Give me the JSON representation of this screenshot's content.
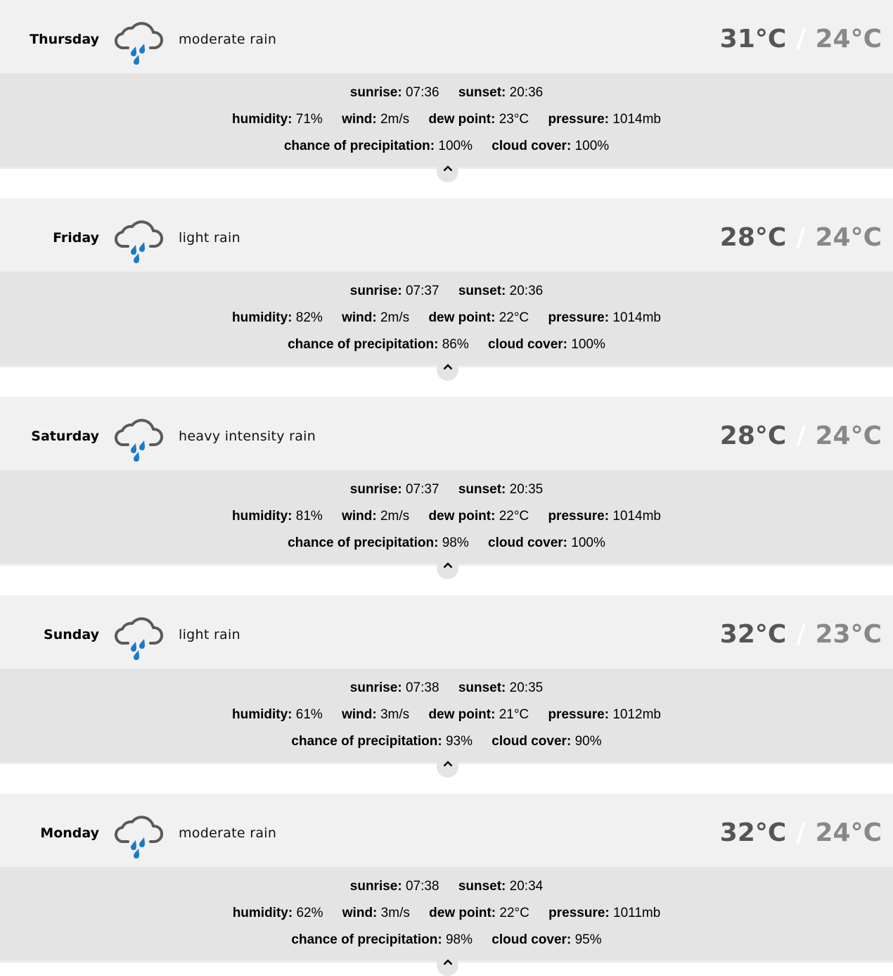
{
  "labels": {
    "sunrise": "sunrise:",
    "sunset": "sunset:",
    "humidity": "humidity:",
    "wind": "wind:",
    "dew_point": "dew point:",
    "pressure": "pressure:",
    "precipitation": "chance of precipitation:",
    "cloud_cover": "cloud cover:",
    "temp_separator": "/"
  },
  "icon": "rain-cloud-icon",
  "colors": {
    "rain_drop": "#1a7ac8",
    "cloud": "#5a5a5a",
    "temp_high": "#555555",
    "temp_low": "#888888"
  },
  "days": [
    {
      "name": "Thursday",
      "description": "moderate rain",
      "high": "31°C",
      "low": "24°C",
      "sunrise": "07:36",
      "sunset": "20:36",
      "humidity": "71%",
      "wind": "2m/s",
      "dew_point": "23°C",
      "pressure": "1014mb",
      "precipitation": "100%",
      "cloud_cover": "100%"
    },
    {
      "name": "Friday",
      "description": "light rain",
      "high": "28°C",
      "low": "24°C",
      "sunrise": "07:37",
      "sunset": "20:36",
      "humidity": "82%",
      "wind": "2m/s",
      "dew_point": "22°C",
      "pressure": "1014mb",
      "precipitation": "86%",
      "cloud_cover": "100%"
    },
    {
      "name": "Saturday",
      "description": "heavy intensity rain",
      "high": "28°C",
      "low": "24°C",
      "sunrise": "07:37",
      "sunset": "20:35",
      "humidity": "81%",
      "wind": "2m/s",
      "dew_point": "22°C",
      "pressure": "1014mb",
      "precipitation": "98%",
      "cloud_cover": "100%"
    },
    {
      "name": "Sunday",
      "description": "light rain",
      "high": "32°C",
      "low": "23°C",
      "sunrise": "07:38",
      "sunset": "20:35",
      "humidity": "61%",
      "wind": "3m/s",
      "dew_point": "21°C",
      "pressure": "1012mb",
      "precipitation": "93%",
      "cloud_cover": "90%"
    },
    {
      "name": "Monday",
      "description": "moderate rain",
      "high": "32°C",
      "low": "24°C",
      "sunrise": "07:38",
      "sunset": "20:34",
      "humidity": "62%",
      "wind": "3m/s",
      "dew_point": "22°C",
      "pressure": "1011mb",
      "precipitation": "98%",
      "cloud_cover": "95%"
    }
  ]
}
